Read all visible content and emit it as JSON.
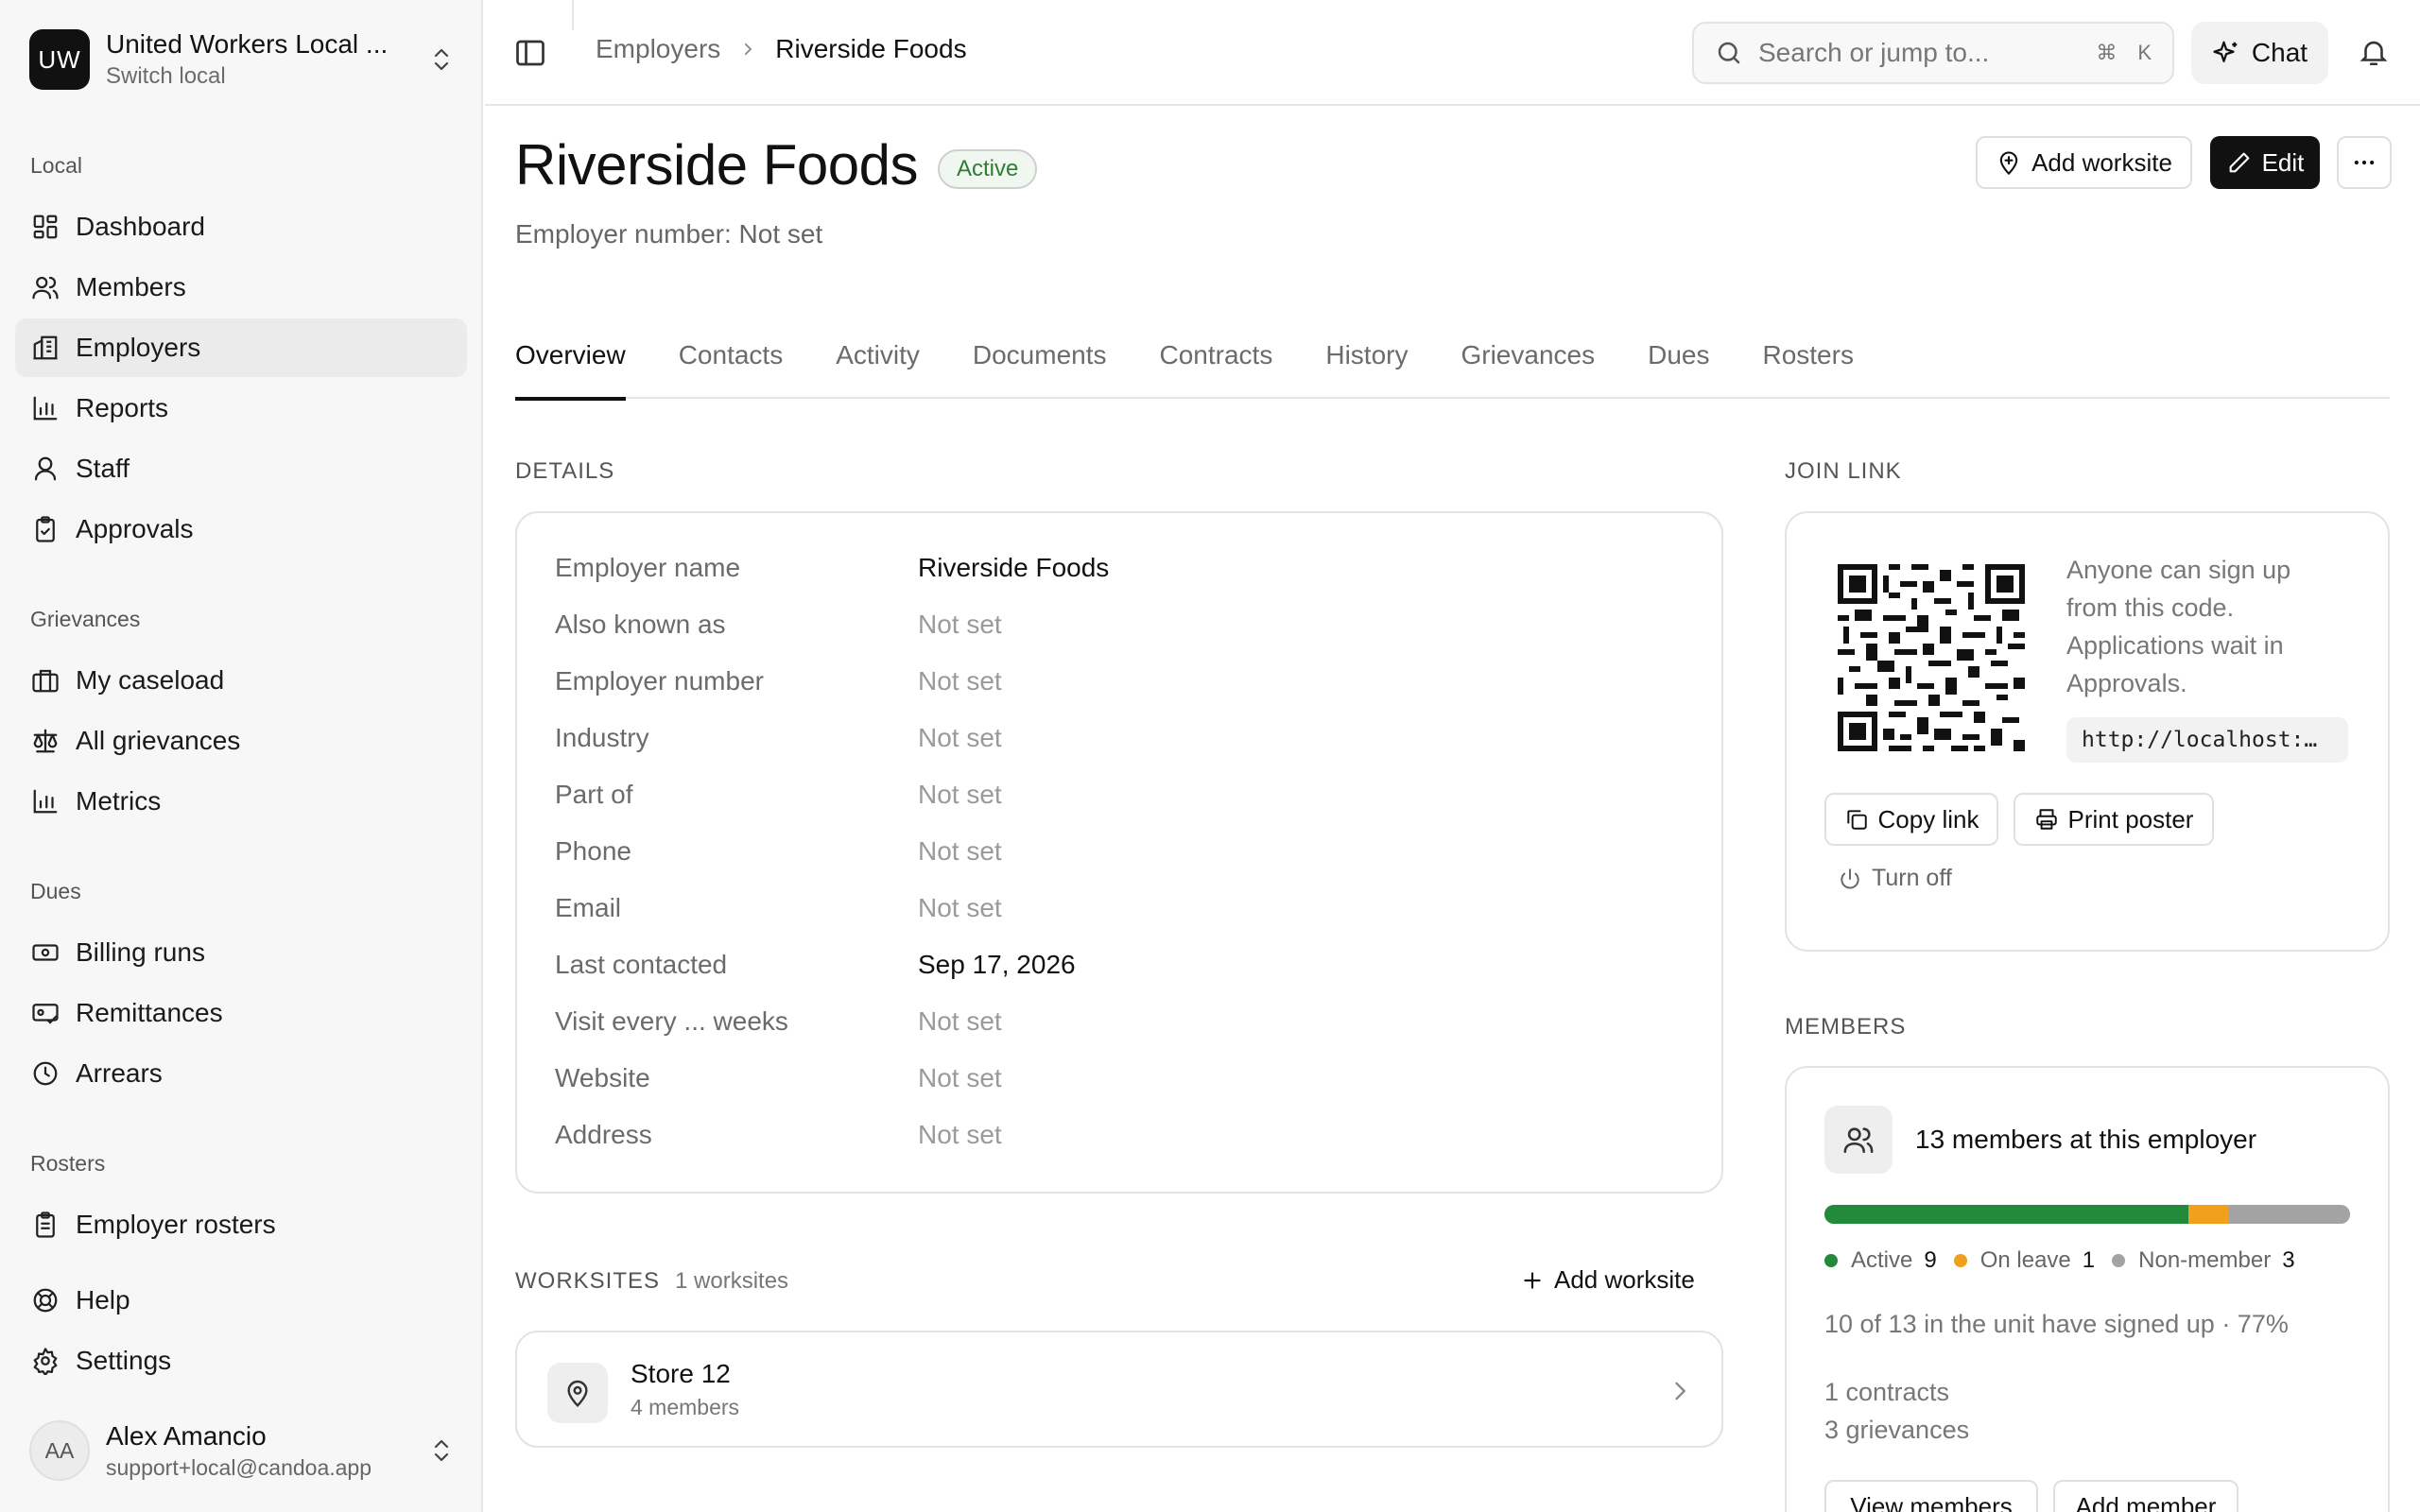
{
  "org": {
    "initials": "UW",
    "name": "United Workers Local ...",
    "sub": "Switch local"
  },
  "nav": {
    "local_label": "Local",
    "local": [
      {
        "label": "Dashboard",
        "icon": "dashboard-icon"
      },
      {
        "label": "Members",
        "icon": "members-icon"
      },
      {
        "label": "Employers",
        "icon": "building-icon",
        "active": true
      },
      {
        "label": "Reports",
        "icon": "bar-chart-icon"
      },
      {
        "label": "Staff",
        "icon": "user-icon"
      },
      {
        "label": "Approvals",
        "icon": "clipboard-check-icon"
      }
    ],
    "grievances_label": "Grievances",
    "grievances": [
      {
        "label": "My caseload",
        "icon": "briefcase-icon"
      },
      {
        "label": "All grievances",
        "icon": "scale-icon"
      },
      {
        "label": "Metrics",
        "icon": "bar-chart-icon"
      }
    ],
    "dues_label": "Dues",
    "dues": [
      {
        "label": "Billing runs",
        "icon": "banknote-icon"
      },
      {
        "label": "Remittances",
        "icon": "wallet-check-icon"
      },
      {
        "label": "Arrears",
        "icon": "clock-icon"
      }
    ],
    "rosters_label": "Rosters",
    "rosters": [
      {
        "label": "Employer rosters",
        "icon": "clipboard-list-icon"
      }
    ],
    "footer": [
      {
        "label": "Help",
        "icon": "lifebuoy-icon"
      },
      {
        "label": "Settings",
        "icon": "gear-icon"
      }
    ]
  },
  "user": {
    "initials": "AA",
    "name": "Alex Amancio",
    "email": "support+local@candoa.app"
  },
  "topbar": {
    "breadcrumb_parent": "Employers",
    "breadcrumb_current": "Riverside Foods",
    "search_placeholder": "Search or jump to...",
    "search_kbd_cmd": "⌘",
    "search_kbd_key": "K",
    "chat_label": "Chat"
  },
  "header": {
    "title": "Riverside Foods",
    "status": "Active",
    "subtitle": "Employer number: Not set",
    "add_worksite": "Add worksite",
    "edit": "Edit"
  },
  "tabs": [
    "Overview",
    "Contacts",
    "Activity",
    "Documents",
    "Contracts",
    "History",
    "Grievances",
    "Dues",
    "Rosters"
  ],
  "details": {
    "label": "DETAILS",
    "rows": [
      {
        "label": "Employer name",
        "value": "Riverside Foods",
        "muted": false
      },
      {
        "label": "Also known as",
        "value": "Not set",
        "muted": true
      },
      {
        "label": "Employer number",
        "value": "Not set",
        "muted": true
      },
      {
        "label": "Industry",
        "value": "Not set",
        "muted": true
      },
      {
        "label": "Part of",
        "value": "Not set",
        "muted": true
      },
      {
        "label": "Phone",
        "value": "Not set",
        "muted": true
      },
      {
        "label": "Email",
        "value": "Not set",
        "muted": true
      },
      {
        "label": "Last contacted",
        "value": "Sep 17, 2026",
        "muted": false
      },
      {
        "label": "Visit every ... weeks",
        "value": "Not set",
        "muted": true
      },
      {
        "label": "Website",
        "value": "Not set",
        "muted": true
      },
      {
        "label": "Address",
        "value": "Not set",
        "muted": true
      }
    ]
  },
  "worksites": {
    "label": "WORKSITES",
    "count": "1 worksites",
    "add_label": "Add worksite",
    "items": [
      {
        "name": "Store 12",
        "sub": "4 members"
      }
    ]
  },
  "join_link": {
    "label": "JOIN LINK",
    "description": "Anyone can sign up from this code. Applications wait in Approvals.",
    "url": "http://localhost:…",
    "copy_label": "Copy link",
    "print_label": "Print poster",
    "turn_off_label": "Turn off"
  },
  "members": {
    "label": "MEMBERS",
    "title": "13 members at this employer",
    "breakdown": [
      {
        "label": "Active",
        "value": 9,
        "color": "#238a3b"
      },
      {
        "label": "On leave",
        "value": 1,
        "color": "#f0a01a"
      },
      {
        "label": "Non-member",
        "value": 3,
        "color": "#a3a3a3"
      }
    ],
    "signed_up": "10 of 13 in the unit have signed up · 77%",
    "contracts": "1 contracts",
    "grievances": "3 grievances",
    "view_members": "View members",
    "add_member": "Add member"
  }
}
